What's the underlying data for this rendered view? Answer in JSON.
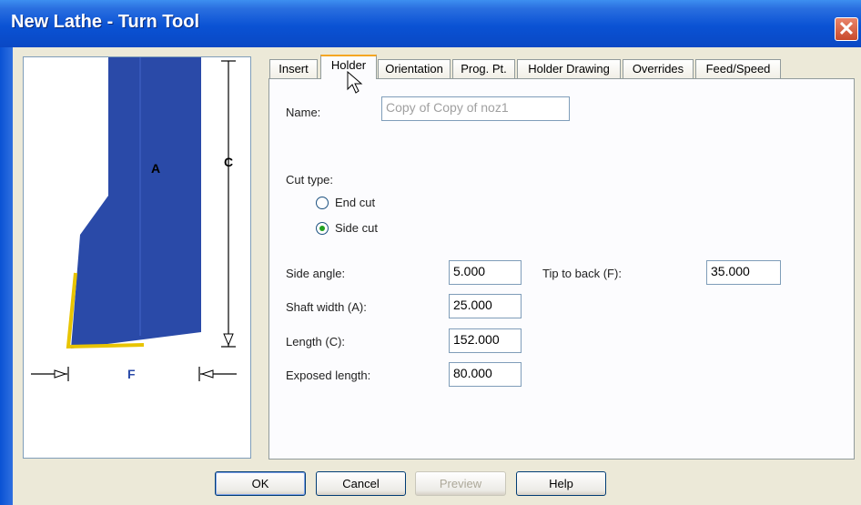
{
  "window": {
    "title": "New Lathe - Turn Tool",
    "close_glyph": "✕"
  },
  "drawing": {
    "label_a": "A",
    "label_c": "C",
    "label_f": "F"
  },
  "tabs": [
    {
      "label": "Insert",
      "active": false
    },
    {
      "label": "Holder",
      "active": true
    },
    {
      "label": "Orientation",
      "active": false
    },
    {
      "label": "Prog. Pt.",
      "active": false
    },
    {
      "label": "Holder Drawing",
      "active": false
    },
    {
      "label": "Overrides",
      "active": false
    },
    {
      "label": "Feed/Speed",
      "active": false
    }
  ],
  "holder": {
    "name_label": "Name:",
    "name_value": "Copy of Copy of noz1",
    "cut_type_label": "Cut type:",
    "cut_options": [
      {
        "label": "End cut",
        "checked": false
      },
      {
        "label": "Side cut",
        "checked": true
      }
    ],
    "side_angle_label": "Side angle:",
    "side_angle_value": "5.000",
    "shaft_width_label": "Shaft width (A):",
    "shaft_width_value": "25.000",
    "length_label": "Length (C):",
    "length_value": "152.000",
    "exposed_length_label": "Exposed length:",
    "exposed_length_value": "80.000",
    "tip_to_back_label": "Tip to back (F):",
    "tip_to_back_value": "35.000"
  },
  "buttons": {
    "ok": "OK",
    "cancel": "Cancel",
    "preview": "Preview",
    "help": "Help"
  },
  "colors": {
    "holder_fill": "#2a4aa8",
    "insert_edge": "#e8c400",
    "accent_tab": "#f5a623"
  }
}
